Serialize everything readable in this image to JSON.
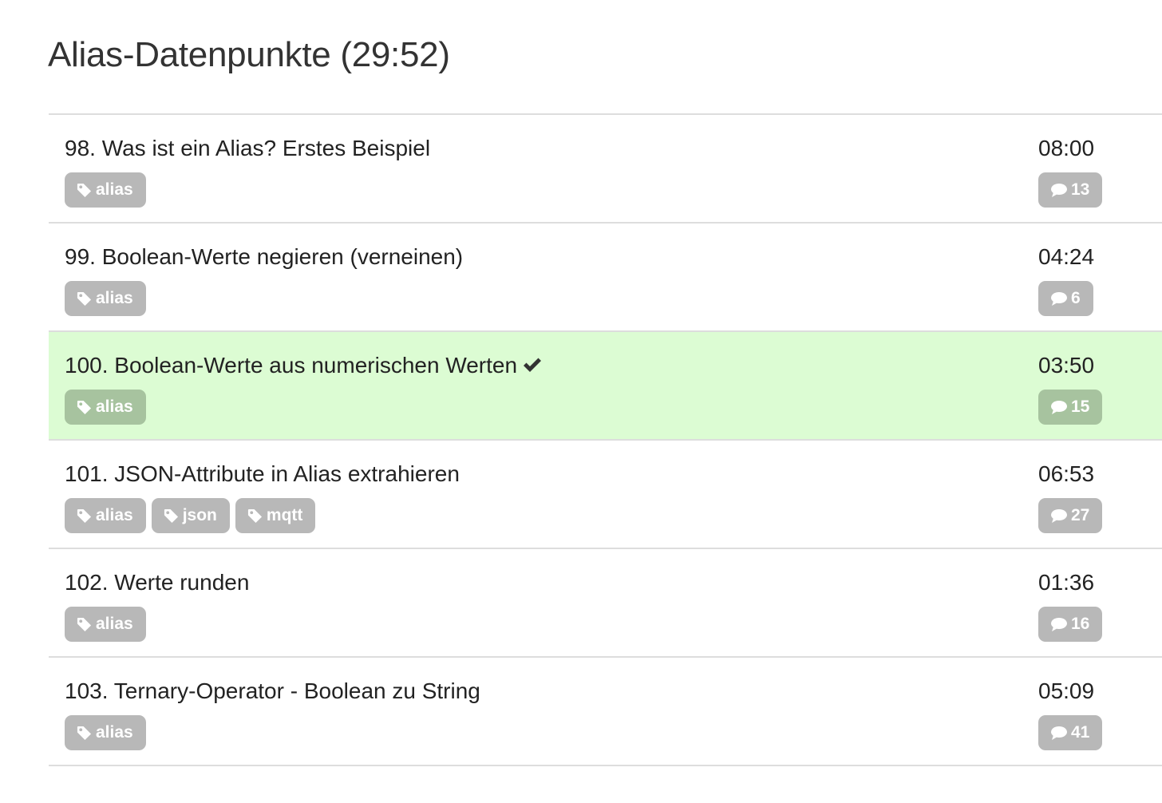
{
  "section": {
    "title": "Alias-Datenpunkte (29:52)"
  },
  "lessons": [
    {
      "title": "98. Was ist ein Alias? Erstes Beispiel",
      "duration": "08:00",
      "comments": "13",
      "completed": false,
      "tags": [
        "alias"
      ]
    },
    {
      "title": "99. Boolean-Werte negieren (verneinen)",
      "duration": "04:24",
      "comments": "6",
      "completed": false,
      "tags": [
        "alias"
      ]
    },
    {
      "title": "100. Boolean-Werte aus numerischen Werten",
      "duration": "03:50",
      "comments": "15",
      "completed": true,
      "tags": [
        "alias"
      ]
    },
    {
      "title": "101. JSON-Attribute in Alias extrahieren",
      "duration": "06:53",
      "comments": "27",
      "completed": false,
      "tags": [
        "alias",
        "json",
        "mqtt"
      ]
    },
    {
      "title": "102. Werte runden",
      "duration": "01:36",
      "comments": "16",
      "completed": false,
      "tags": [
        "alias"
      ]
    },
    {
      "title": "103. Ternary-Operator - Boolean zu String",
      "duration": "05:09",
      "comments": "41",
      "completed": false,
      "tags": [
        "alias"
      ]
    }
  ],
  "icons": {
    "tag": "tag-icon",
    "comment": "comment-icon",
    "completed": "checkmark-icon"
  },
  "colors": {
    "completed_row": "#dcfcd3",
    "badge": "#b8b8b8",
    "badge_completed": "#a7c39f",
    "divider": "#dddddd"
  }
}
